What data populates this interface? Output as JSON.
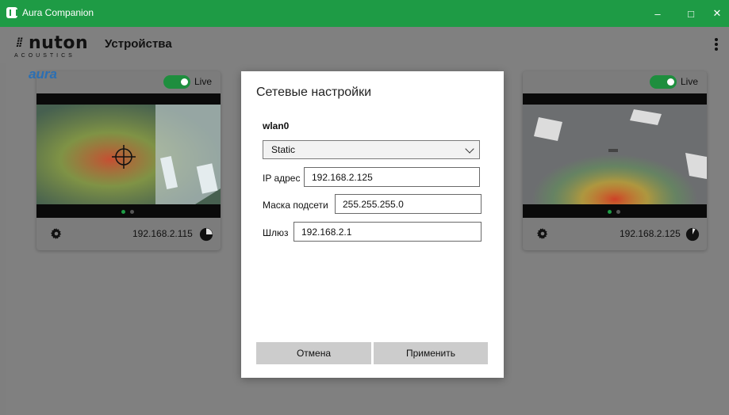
{
  "window": {
    "title": "Aura Companion"
  },
  "header": {
    "logo_text": "nuton",
    "logo_sub": "ACOUSTICS",
    "title": "Устройства"
  },
  "cards": [
    {
      "brand": "aura",
      "live_label": "Live",
      "live_on": true,
      "ip": "192.168.2.115"
    },
    {
      "brand": "",
      "live_label": "Live",
      "live_on": true,
      "ip": "192.168.2.125"
    }
  ],
  "dialog": {
    "title": "Сетевые настройки",
    "interface": "wlan0",
    "mode": "Static",
    "ip_label": "IP адрес",
    "ip_value": "192.168.2.125",
    "mask_label": "Маска подсети",
    "mask_value": "255.255.255.0",
    "gateway_label": "Шлюз",
    "gateway_value": "192.168.2.1",
    "cancel_label": "Отмена",
    "apply_label": "Применить"
  },
  "colors": {
    "titlebar": "#1e9b45",
    "toggle": "#1e8e3e",
    "overlay": "#808080"
  }
}
